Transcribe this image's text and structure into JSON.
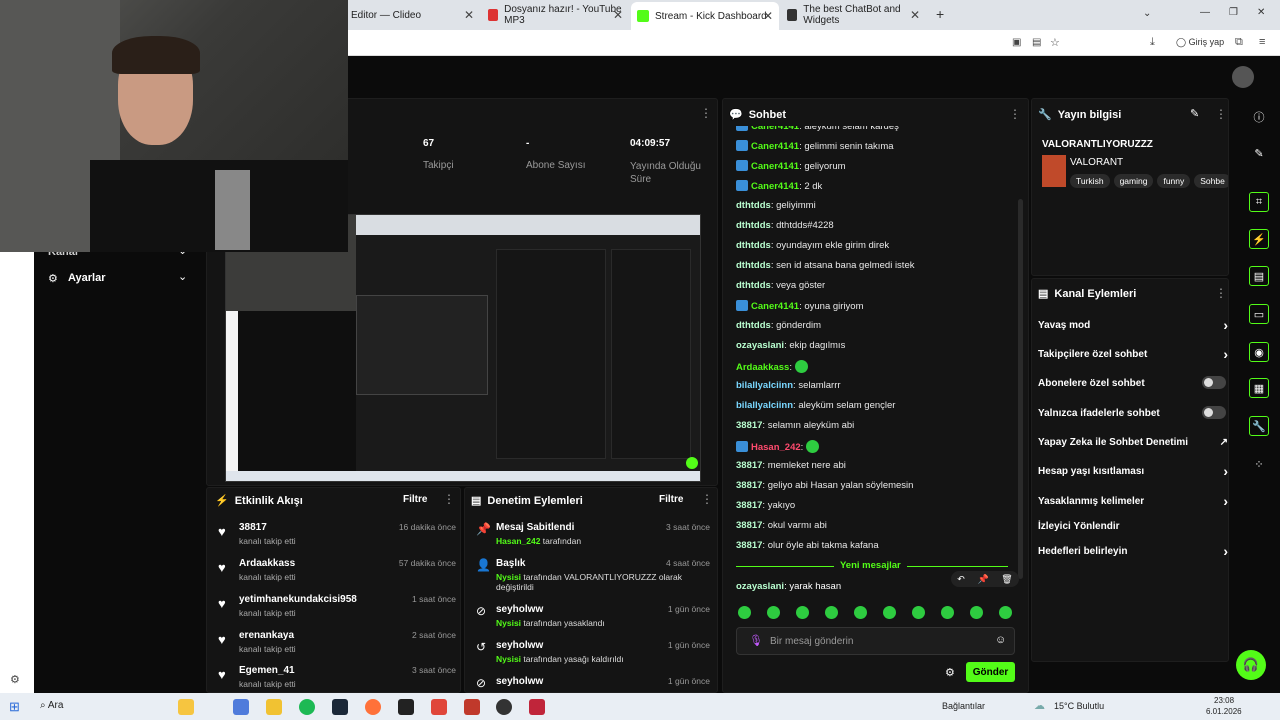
{
  "browser": {
    "tabs": [
      {
        "label": "Editor — Clideo"
      },
      {
        "label": "Dosyanız hazır! - YouTube MP3"
      },
      {
        "label": "Stream - Kick Dashboard"
      },
      {
        "label": "The best ChatBot and Widgets"
      }
    ],
    "login_label": "Giriş yap"
  },
  "sidebar": {
    "items": [
      {
        "label": "Kanal"
      },
      {
        "label": "Ayarlar"
      }
    ]
  },
  "stats": [
    {
      "value": "67",
      "label": "Takipçi"
    },
    {
      "value": "-",
      "label": "Abone Sayısı"
    },
    {
      "value": "04:09:57",
      "label": "Yayında Olduğu Süre"
    }
  ],
  "activity": {
    "title": "Etkinlik Akışı",
    "filter": "Filtre",
    "items": [
      {
        "name": "38817",
        "sub": "kanalı takip etti",
        "time": "16 dakika önce"
      },
      {
        "name": "Ardaakkass",
        "sub": "kanalı takip etti",
        "time": "57 dakika önce"
      },
      {
        "name": "yetimhanekundakcisi958",
        "sub": "kanalı takip etti",
        "time": "1 saat önce"
      },
      {
        "name": "erenankaya",
        "sub": "kanalı takip etti",
        "time": "2 saat önce"
      },
      {
        "name": "Egemen_41",
        "sub": "kanalı takip etti",
        "time": "3 saat önce"
      }
    ]
  },
  "moderation": {
    "title": "Denetim Eylemleri",
    "filter": "Filtre",
    "items": [
      {
        "name": "Mesaj Sabitlendi",
        "actor": "Hasan_242",
        "rest": " tarafından",
        "time": "3 saat önce"
      },
      {
        "name": "Başlık",
        "actor": "Nysisi",
        "rest": " tarafından VALORANTLIYORUZZZ olarak değiştirildi",
        "time": "4 saat önce"
      },
      {
        "name": "seyholww",
        "actor": "Nysisi",
        "rest": " tarafından yasaklandı",
        "time": "1 gün önce"
      },
      {
        "name": "seyholww",
        "actor": "Nysisi",
        "rest": " tarafından yasağı kaldırıldı",
        "time": "1 gün önce"
      },
      {
        "name": "seyholww",
        "actor": "",
        "rest": "",
        "time": "1 gün önce"
      }
    ]
  },
  "chat": {
    "title": "Sohbet",
    "messages": [
      {
        "user": "Caner4141",
        "color": "#53fc18",
        "badge": true,
        "text": "aleyküm selam kardeş"
      },
      {
        "user": "Caner4141",
        "color": "#53fc18",
        "badge": true,
        "text": "gelimmi senin takıma"
      },
      {
        "user": "Caner4141",
        "color": "#53fc18",
        "badge": true,
        "text": "geliyorum"
      },
      {
        "user": "Caner4141",
        "color": "#53fc18",
        "badge": true,
        "text": "2 dk"
      },
      {
        "user": "dthtdds",
        "color": "#b9ffd0",
        "badge": false,
        "text": "geliyimmi"
      },
      {
        "user": "dthtdds",
        "color": "#b9ffd0",
        "badge": false,
        "text": "dthtdds#4228"
      },
      {
        "user": "dthtdds",
        "color": "#b9ffd0",
        "badge": false,
        "text": "oyundayım ekle girim direk"
      },
      {
        "user": "dthtdds",
        "color": "#b9ffd0",
        "badge": false,
        "text": "sen id atsana bana gelmedi istek"
      },
      {
        "user": "dthtdds",
        "color": "#b9ffd0",
        "badge": false,
        "text": "veya göster"
      },
      {
        "user": "Caner4141",
        "color": "#53fc18",
        "badge": true,
        "text": "oyuna giriyom"
      },
      {
        "user": "dthtdds",
        "color": "#b9ffd0",
        "badge": false,
        "text": "gönderdim"
      },
      {
        "user": "ozayaslani",
        "color": "#b9ffd0",
        "badge": false,
        "text": "ekip dagılmıs"
      },
      {
        "user": "Ardaakkass",
        "color": "#53fc18",
        "badge": false,
        "text": ""
      },
      {
        "user": "bilallyalciinn",
        "color": "#7ad7ff",
        "badge": false,
        "text": "selamlarrr"
      },
      {
        "user": "bilallyalciinn",
        "color": "#7ad7ff",
        "badge": false,
        "text": "aleyküm selam gençler"
      },
      {
        "user": "38817",
        "color": "#b9ffd0",
        "badge": false,
        "text": "selamın aleyküm abi"
      },
      {
        "user": "Hasan_242",
        "color": "#ff4b6e",
        "badge": true,
        "text": ""
      },
      {
        "user": "38817",
        "color": "#b9ffd0",
        "badge": false,
        "text": "memleket nere abi"
      },
      {
        "user": "38817",
        "color": "#b9ffd0",
        "badge": false,
        "text": "geliyo abi Hasan yalan söylemesin"
      },
      {
        "user": "38817",
        "color": "#b9ffd0",
        "badge": false,
        "text": "yakıyo"
      },
      {
        "user": "38817",
        "color": "#b9ffd0",
        "badge": false,
        "text": "okul varmı abi"
      },
      {
        "user": "38817",
        "color": "#b9ffd0",
        "badge": false,
        "text": "olur öyle abi takma kafana"
      }
    ],
    "new_messages": "Yeni mesajlar",
    "last_message": {
      "user": "ozayaslani",
      "text": "yarak hasan"
    },
    "input_placeholder": "Bir mesaj gönderin",
    "send_label": "Gönder"
  },
  "stream_info": {
    "title": "Yayın bilgisi",
    "stream_title": "VALORANTLIYORUZZZ",
    "category": "VALORANT",
    "tags": [
      "Turkish",
      "gaming",
      "funny",
      "Sohbe"
    ]
  },
  "channel_actions": {
    "title": "Kanal Eylemleri",
    "items": [
      {
        "label": "Yavaş mod",
        "control": "chevron"
      },
      {
        "label": "Takipçilere özel sohbet",
        "control": "chevron"
      },
      {
        "label": "Abonelere özel sohbet",
        "control": "toggle"
      },
      {
        "label": "Yalnızca ifadelerle sohbet",
        "control": "toggle"
      },
      {
        "label": "Yapay Zeka ile Sohbet Denetimi",
        "control": "external"
      },
      {
        "label": "Hesap yaşı kısıtlaması",
        "control": "chevron"
      },
      {
        "label": "Yasaklanmış kelimeler",
        "control": "chevron"
      },
      {
        "label": "İzleyici Yönlendir",
        "control": "none"
      },
      {
        "label": "Hedefleri belirleyin",
        "control": "chevron"
      }
    ]
  },
  "taskbar": {
    "search": "Ara",
    "links": "Bağlantılar",
    "weather": "15°C Bulutlu",
    "time": "23:08",
    "date": "6.01.2026"
  },
  "colors": {
    "accent": "#53fc18",
    "panel": "#141414",
    "background": "#0b0b0b"
  }
}
